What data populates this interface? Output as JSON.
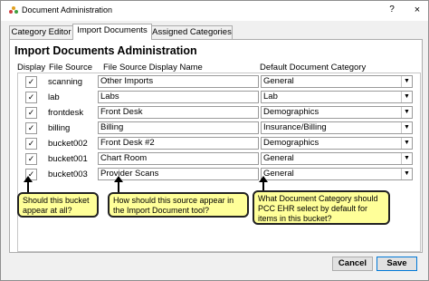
{
  "window": {
    "title": "Document Administration",
    "help": "?",
    "close": "×"
  },
  "tabs": [
    "Category Editor",
    "Import Documents",
    "Assigned Categories"
  ],
  "panel": {
    "heading": "Import Documents Administration",
    "columns": {
      "display": "Display",
      "source": "File Source",
      "display_name": "File Source Display Name",
      "category": "Default Document Category"
    }
  },
  "rows": [
    {
      "checked": true,
      "source": "scanning",
      "display_name": "Other Imports",
      "category": "General"
    },
    {
      "checked": true,
      "source": "lab",
      "display_name": "Labs",
      "category": "Lab"
    },
    {
      "checked": true,
      "source": "frontdesk",
      "display_name": "Front Desk",
      "category": "Demographics"
    },
    {
      "checked": true,
      "source": "billing",
      "display_name": "Billing",
      "category": "Insurance/Billing"
    },
    {
      "checked": true,
      "source": "bucket002",
      "display_name": "Front Desk #2",
      "category": "Demographics"
    },
    {
      "checked": true,
      "source": "bucket001",
      "display_name": "Chart Room",
      "category": "General"
    },
    {
      "checked": true,
      "source": "bucket003",
      "display_name": "Provider Scans",
      "category": "General"
    }
  ],
  "callouts": {
    "display": "Should this bucket appear at all?",
    "name": "How should this source appear in the Import Document tool?",
    "category": "What Document Category should PCC EHR select by default for items in this bucket?"
  },
  "buttons": {
    "cancel": "Cancel",
    "save": "Save"
  },
  "check_glyph": "✓"
}
